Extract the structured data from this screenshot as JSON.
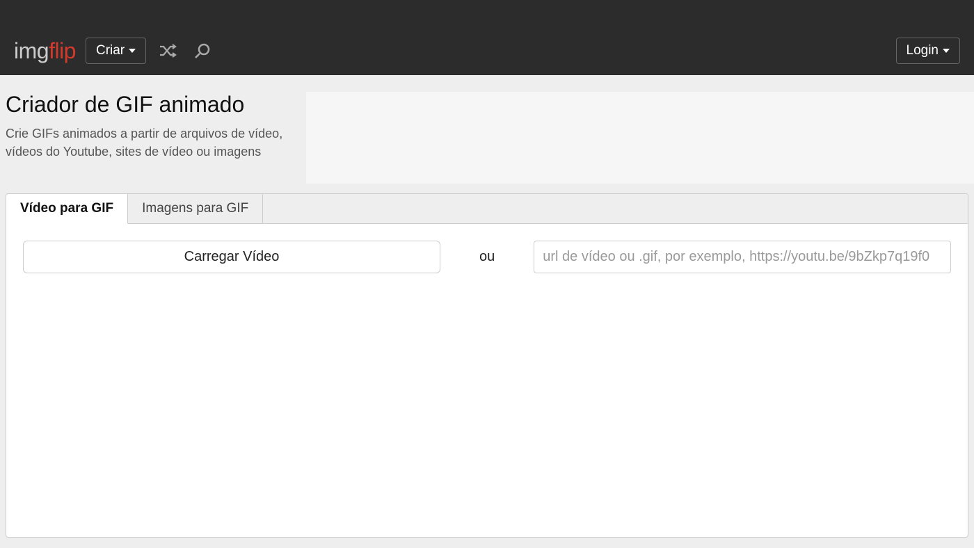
{
  "header": {
    "logo_part1": "img",
    "logo_part2": "flip",
    "create_label": "Criar",
    "login_label": "Login"
  },
  "page": {
    "title": "Criador de GIF animado",
    "subtitle": "Crie GIFs animados a partir de arquivos de vídeo, vídeos do Youtube, sites de vídeo ou imagens"
  },
  "tabs": {
    "video": "Vídeo para GIF",
    "images": "Imagens para GIF"
  },
  "upload": {
    "button_label": "Carregar Vídeo",
    "or_label": "ou",
    "url_placeholder": "url de vídeo ou .gif, por exemplo, https://youtu.be/9bZkp7q19f0"
  }
}
